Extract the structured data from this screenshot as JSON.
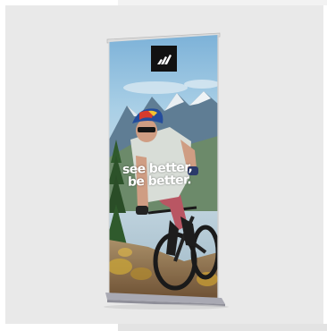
{
  "banner": {
    "slogan_line_1": "see better,",
    "slogan_line_2": "be better."
  },
  "colors": {
    "background": "#e9e9e9",
    "logo_box": "#111111",
    "sky": "#7fb3d7",
    "stand_base": "#a9a9b3"
  }
}
